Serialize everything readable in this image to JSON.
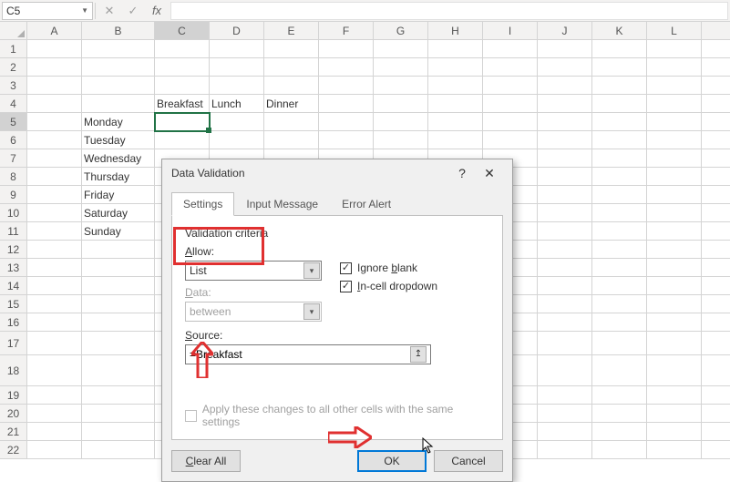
{
  "namebox": {
    "value": "C5"
  },
  "fx_label": "fx",
  "columns": [
    "A",
    "B",
    "C",
    "D",
    "E",
    "F",
    "G",
    "H",
    "I",
    "J",
    "K",
    "L"
  ],
  "rows": [
    1,
    2,
    3,
    4,
    5,
    6,
    7,
    8,
    9,
    10,
    11,
    12,
    13,
    14,
    15,
    16,
    17,
    18,
    19,
    20,
    21,
    22
  ],
  "cells": {
    "r4": {
      "C": "Breakfast",
      "D": "Lunch",
      "E": "Dinner"
    },
    "days": [
      "Monday",
      "Tuesday",
      "Wednesday",
      "Thursday",
      "Friday",
      "Saturday",
      "Sunday"
    ]
  },
  "dialog": {
    "title": "Data Validation",
    "help": "?",
    "close": "✕",
    "tabs": {
      "settings": "Settings",
      "input": "Input Message",
      "error": "Error Alert"
    },
    "criteria_title": "Validation criteria",
    "allow_label": "Allow:",
    "allow_value": "List",
    "data_label": "Data:",
    "data_value": "between",
    "ignore_blank": "Ignore blank",
    "incell_dd": "In-cell dropdown",
    "source_label": "Source:",
    "source_value": "=Breakfast",
    "apply_label": "Apply these changes to all other cells with the same settings",
    "clear": "Clear All",
    "ok": "OK",
    "cancel": "Cancel"
  }
}
